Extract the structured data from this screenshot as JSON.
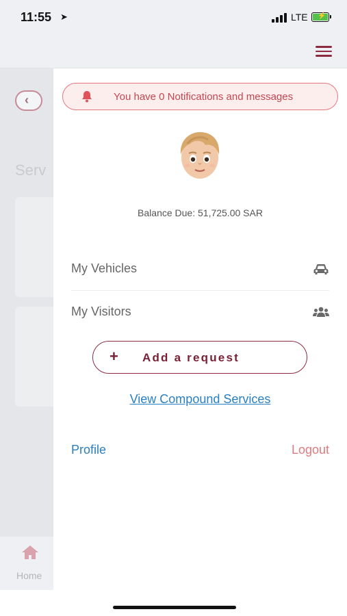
{
  "status_bar": {
    "time": "11:55",
    "network": "LTE",
    "icons": [
      "location-arrow-icon",
      "signal-icon",
      "battery-charging-icon"
    ]
  },
  "header": {
    "menu_icon": "hamburger-menu-icon",
    "accent_color": "#8e2a40"
  },
  "background_page": {
    "title_partial": "Serv",
    "back_icon": "chevron-left-icon",
    "tab_bar": {
      "home_label": "Home",
      "home_icon": "home-icon"
    }
  },
  "drawer": {
    "notification": {
      "icon": "bell-icon",
      "text": "You have 0 Notifications and messages",
      "color": "#c4464f"
    },
    "avatar": {
      "icon": "user-avatar"
    },
    "balance_text": "Balance Due: 51,725.00 SAR",
    "menu": [
      {
        "label": "My Vehicles",
        "icon": "car-icon"
      },
      {
        "label": "My Visitors",
        "icon": "users-icon"
      }
    ],
    "add_request": {
      "icon": "plus-icon",
      "label": "Add a request"
    },
    "view_services_link": "View Compound Services",
    "profile_link": "Profile",
    "logout_link": "Logout"
  }
}
